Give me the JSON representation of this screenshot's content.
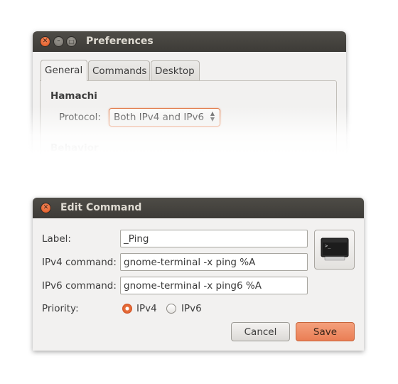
{
  "preferences": {
    "title": "Preferences",
    "tabs": [
      {
        "label": "General",
        "active": true
      },
      {
        "label": "Commands",
        "active": false
      },
      {
        "label": "Desktop",
        "active": false
      }
    ],
    "section_hamachi": "Hamachi",
    "protocol_label": "Protocol:",
    "protocol_value": "Both IPv4 and IPv6",
    "section_behavior": "Behavior"
  },
  "edit_command": {
    "title": "Edit Command",
    "label_label": "Label:",
    "label_value": "_Ping",
    "ipv4_label": "IPv4 command:",
    "ipv4_value": "gnome-terminal -x ping %A",
    "ipv6_label": "IPv6 command:",
    "ipv6_value": "gnome-terminal -x ping6 %A",
    "priority_label": "Priority:",
    "priority_options": [
      {
        "label": "IPv4",
        "checked": true
      },
      {
        "label": "IPv6",
        "checked": false
      }
    ],
    "cancel_label": "Cancel",
    "save_label": "Save",
    "icon": "terminal-icon"
  },
  "colors": {
    "accent": "#e07744",
    "titlebar": "#3d3b37",
    "window_bg": "#f2f1f0"
  }
}
